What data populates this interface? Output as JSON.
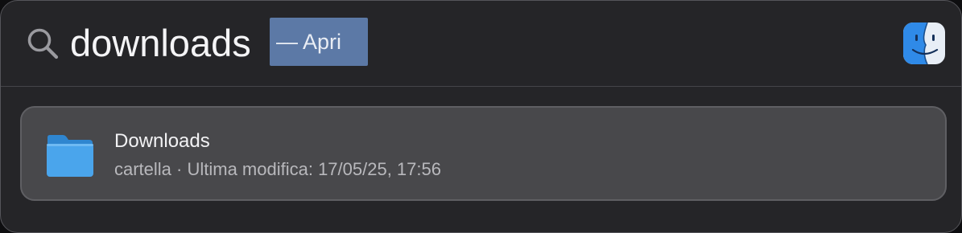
{
  "search": {
    "query": "downloads",
    "completion": "— Apri",
    "search_icon": "magnifier-icon",
    "app_icon": "finder-icon"
  },
  "results": [
    {
      "icon": "folder-icon",
      "title": "Downloads",
      "subtitle": "cartella · Ultima modifica: 17/05/25, 17:56"
    }
  ],
  "colors": {
    "panel_background": "#252528",
    "selected_row": "#48484b",
    "completion_highlight": "#5c79a6",
    "folder_blue": "#3f9be0"
  }
}
